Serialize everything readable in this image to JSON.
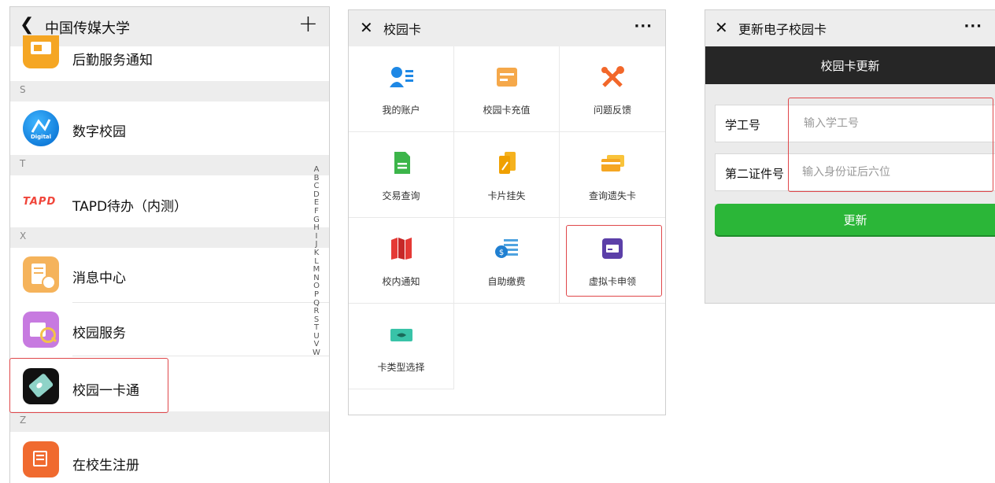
{
  "left_panel": {
    "title": "中国传媒大学",
    "items": [
      {
        "label": "后勤服务通知"
      },
      {
        "label": "数字校园",
        "icon_text": "Digital"
      },
      {
        "label": "TAPD待办（内测）",
        "logo_text": "TAPD"
      },
      {
        "label": "消息中心"
      },
      {
        "label": "校园服务"
      },
      {
        "label": "校园一卡通"
      },
      {
        "label": "在校生注册"
      }
    ],
    "sections": [
      "S",
      "T",
      "X",
      "Z"
    ],
    "index_letters": [
      "A",
      "B",
      "C",
      "D",
      "E",
      "F",
      "G",
      "H",
      "I",
      "J",
      "K",
      "L",
      "M",
      "N",
      "O",
      "P",
      "Q",
      "R",
      "S",
      "T",
      "U",
      "V",
      "W"
    ]
  },
  "middle_panel": {
    "title": "校园卡",
    "menu": "···",
    "grid": [
      {
        "label": "我的账户",
        "icon": "account-icon"
      },
      {
        "label": "校园卡充值",
        "icon": "card-recharge-icon"
      },
      {
        "label": "问题反馈",
        "icon": "tools-icon"
      },
      {
        "label": "交易查询",
        "icon": "document-icon"
      },
      {
        "label": "卡片挂失",
        "icon": "card-loss-icon"
      },
      {
        "label": "查询遗失卡",
        "icon": "lost-card-icon"
      },
      {
        "label": "校内通知",
        "icon": "map-icon"
      },
      {
        "label": "自助缴费",
        "icon": "payment-icon"
      },
      {
        "label": "虚拟卡申领",
        "icon": "virtual-card-icon"
      },
      {
        "label": "卡类型选择",
        "icon": "card-type-icon"
      }
    ]
  },
  "right_panel": {
    "title": "更新电子校园卡",
    "menu": "···",
    "subtitle": "校园卡更新",
    "fields": [
      {
        "label": "学工号",
        "placeholder": "输入学工号"
      },
      {
        "label": "第二证件号",
        "placeholder": "输入身份证后六位"
      }
    ],
    "button": "更新"
  },
  "colors": {
    "highlight": "#e0474a",
    "primary_green": "#2bb638",
    "dark_bar": "#262626"
  }
}
